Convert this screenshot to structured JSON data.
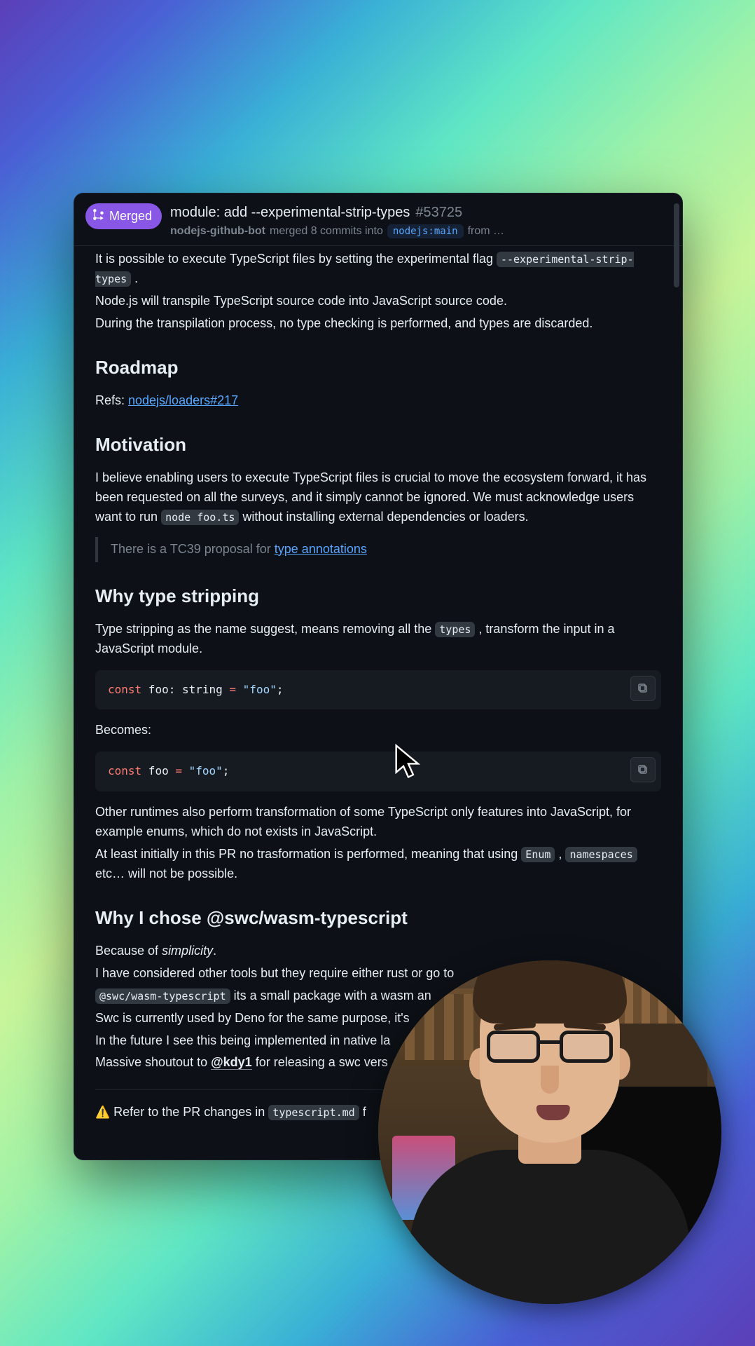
{
  "header": {
    "status": "Merged",
    "title": "module: add --experimental-strip-types",
    "pr_number": "#53725",
    "actor": "nodejs-github-bot",
    "merged_text": "merged 8 commits into",
    "branch": "nodejs:main",
    "from_text": "from …"
  },
  "body": {
    "intro1a": "It is possible to execute TypeScript files by setting the experimental flag ",
    "intro1_code": "--experimental-strip-types",
    "intro1b": " .",
    "intro2": "Node.js will transpile TypeScript source code into JavaScript source code.",
    "intro3": "During the transpilation process, no type checking is performed, and types are discarded.",
    "roadmap_h": "Roadmap",
    "refs_label": "Refs: ",
    "refs_link": "nodejs/loaders#217",
    "motivation_h": "Motivation",
    "motivation_p1a": "I believe enabling users to execute TypeScript files is crucial to move the ecosystem forward, it has been requested on all the surveys, and it simply cannot be ignored. We must acknowledge users want to run ",
    "motivation_code": "node foo.ts",
    "motivation_p1b": " without installing external dependencies or loaders.",
    "quote_a": "There is a TC39 proposal for ",
    "quote_link": "type annotations",
    "why_h": "Why type stripping",
    "why_p1a": "Type stripping as the name suggest, means removing all the ",
    "why_code_types": "types",
    "why_p1b": " , transform the input in a JavaScript module.",
    "code1_kw": "const",
    "code1_id": " foo",
    "code1_ty": ": string ",
    "code1_op": "= ",
    "code1_str": "\"foo\"",
    "code1_end": ";",
    "becomes": "Becomes:",
    "code2_kw": "const",
    "code2_id": " foo ",
    "code2_op": "= ",
    "code2_str": "\"foo\"",
    "code2_end": ";",
    "other_p1": "Other runtimes also perform transformation of some TypeScript only features into JavaScript, for example enums, which do not exists in JavaScript.",
    "other_p2a": "At least initially in this PR no trasformation is performed, meaning that using ",
    "other_enum": "Enum",
    "other_p2b": " , ",
    "other_ns": "namespaces",
    "other_p2c": " etc… will not be possible.",
    "swc_h": "Why I chose @swc/wasm-typescript",
    "swc_p1a": "Because of ",
    "swc_p1em": "simplicity",
    "swc_p1b": ".",
    "swc_p2": "I have considered other tools but they require either rust or go to",
    "swc_p3a": "",
    "swc_pkg": "@swc/wasm-typescript",
    "swc_p3b": " its a small package with a wasm an",
    "swc_p4": "Swc is currently used by Deno for the same purpose, it's",
    "swc_p5": "In the future I see this being implemented in native la",
    "swc_p6a": "Massive shoutout to ",
    "swc_mention": "@kdy1",
    "swc_p6b": " for releasing a swc vers",
    "footer_emoji": "⚠️",
    "footer_a": " Refer to the PR changes in ",
    "footer_code": "typescript.md",
    "footer_b": " f"
  }
}
